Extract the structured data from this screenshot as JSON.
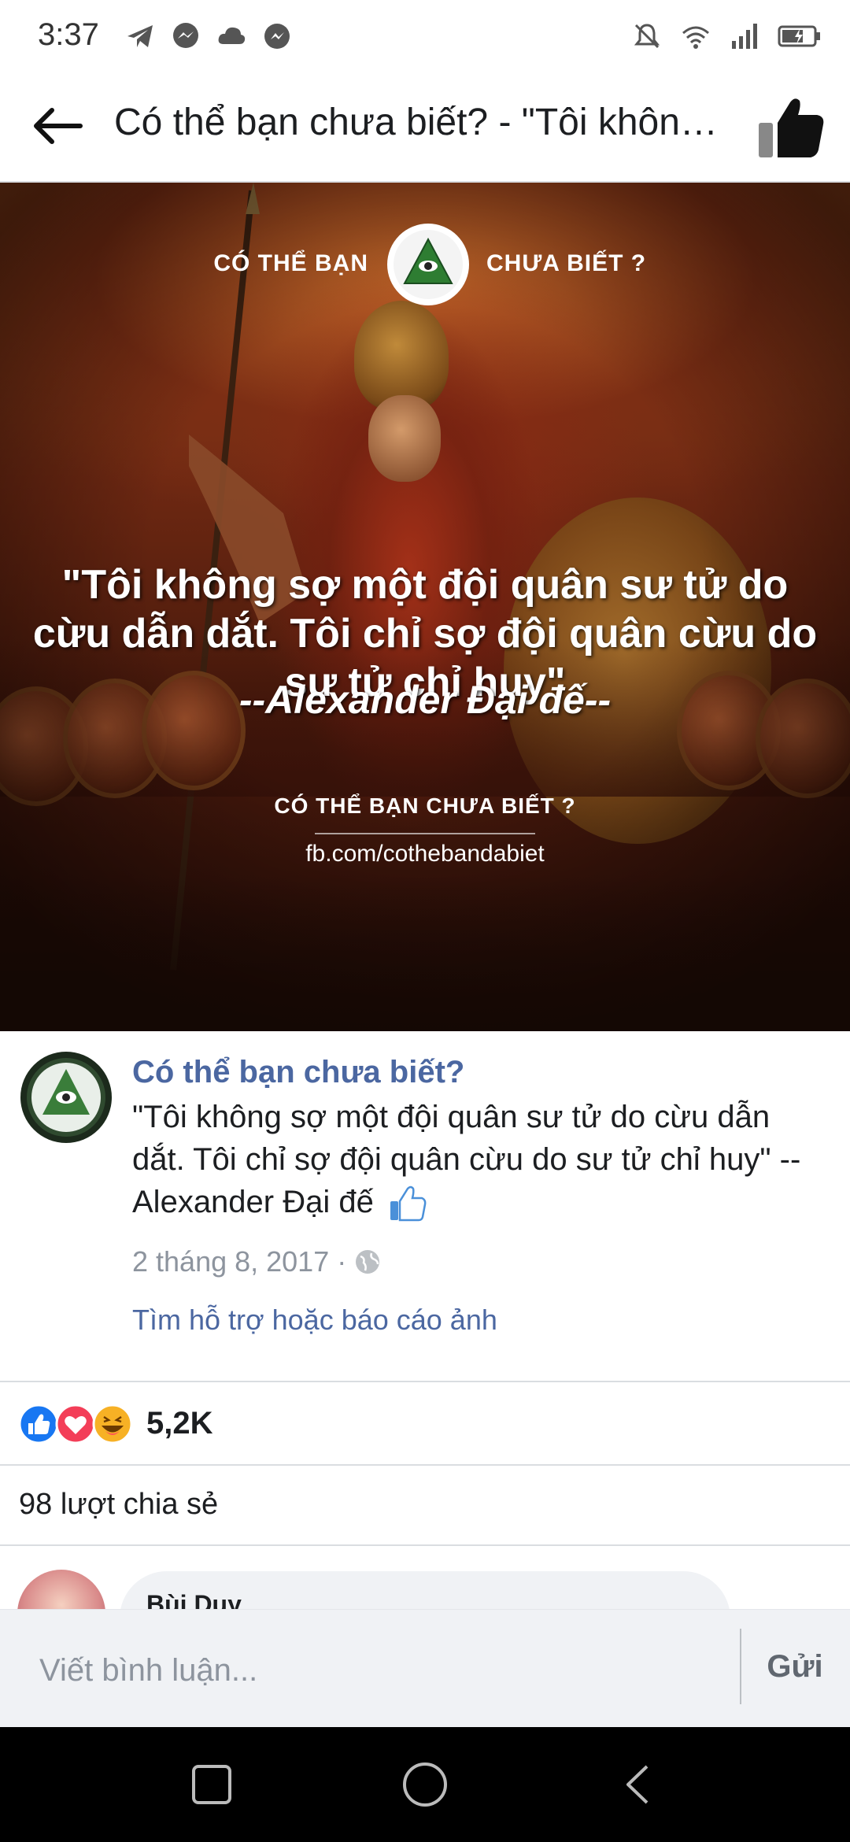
{
  "status_bar": {
    "time": "3:37",
    "left_icons": [
      "telegram-icon",
      "messenger-icon",
      "cloud-icon",
      "messenger-alt-icon"
    ],
    "right_icons": [
      "bell-off-icon",
      "wifi-icon",
      "signal-icon",
      "battery-icon"
    ]
  },
  "header": {
    "title": "Có thể bạn chưa biết? - \"Tôi không sợ một đội quân sư tử do cừu dẫn dắt. Tôi chỉ sợ đội quân cừu do sư tử chỉ huy\" --Alexander Đại đế"
  },
  "photo": {
    "brand_left": "CÓ THỂ BẠN",
    "brand_right": "CHƯA BIẾT ?",
    "quote": "\"Tôi không sợ một đội quân sư tử do cừu dẫn dắt. Tôi chỉ sợ đội quân cừu do sư tử chỉ huy\"",
    "author": "--Alexander Đại đế--",
    "footer_brand": "CÓ THỂ BẠN CHƯA BIẾT ?",
    "footer_url": "fb.com/cothebandabiet"
  },
  "post": {
    "page_name": "Có thể bạn chưa biết?",
    "text": "\"Tôi không sợ một đội quân sư tử do cừu dẫn dắt. Tôi chỉ sợ đội quân cừu do sư tử chỉ huy\" -- Alexander Đại đế",
    "date": "2 tháng 8, 2017 ·",
    "report_link": "Tìm hỗ trợ hoặc báo cáo ảnh"
  },
  "reactions": {
    "types": [
      "like",
      "love",
      "haha"
    ],
    "count": "5,2K"
  },
  "shares": {
    "text": "98 lượt chia sẻ"
  },
  "comment_preview": {
    "author": "Bùi Duy"
  },
  "composer": {
    "placeholder": "Viết bình luận...",
    "send_label": "Gửi"
  },
  "colors": {
    "link_blue": "#4b67a1",
    "like_blue": "#1877f2",
    "love_red": "#f33e58",
    "haha_yellow": "#f7b125",
    "meta_gray": "#8d949e"
  }
}
